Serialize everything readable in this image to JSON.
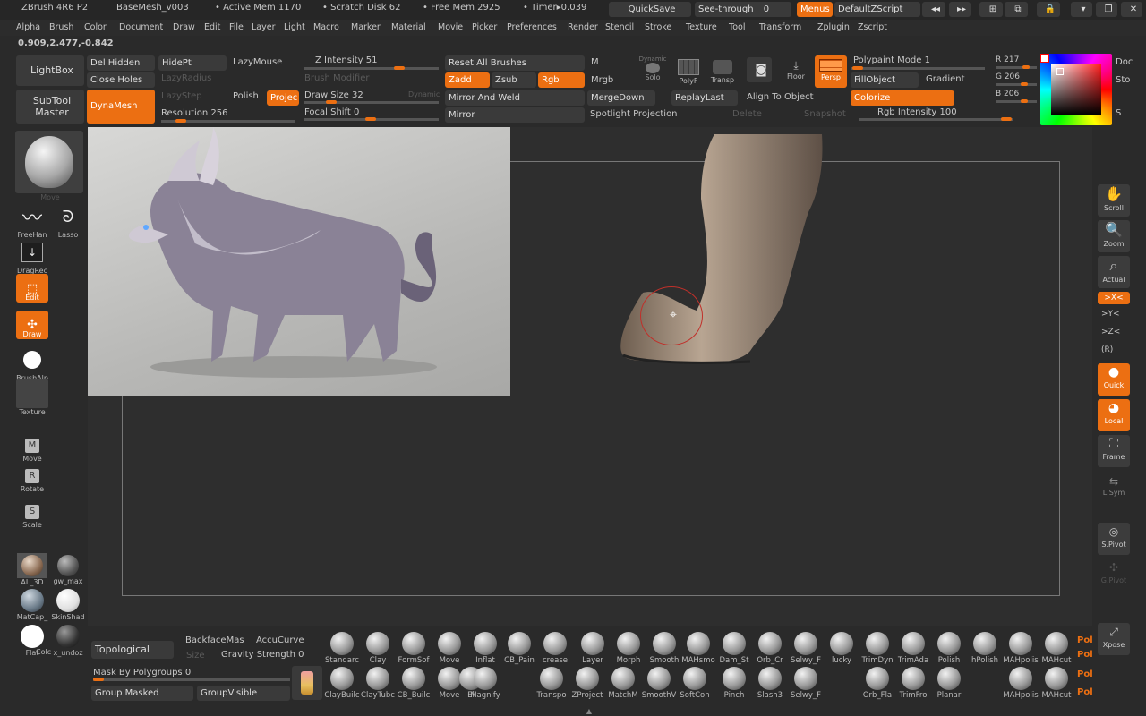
{
  "titlebar": {
    "app": "ZBrush 4R6 P2",
    "file": "BaseMesh_v003",
    "active_mem": "• Active Mem 1170",
    "scratch": "• Scratch Disk 62",
    "free_mem": "• Free Mem 2925",
    "timer": "• Timer▸0.039",
    "quicksave": "QuickSave",
    "seethrough": "See-through",
    "seethrough_val": "0",
    "menus": "Menus",
    "defaultzscript": "DefaultZScript"
  },
  "menubar": [
    "Alpha",
    "Brush",
    "Color",
    "Document",
    "Draw",
    "Edit",
    "File",
    "Layer",
    "Light",
    "Macro",
    "Marker",
    "Material",
    "Movie",
    "Picker",
    "Preferences",
    "Render",
    "Stencil",
    "Stroke",
    "Texture",
    "Tool",
    "Transform",
    "Zplugin",
    "Zscript"
  ],
  "coords": "0.909,2.477,-0.842",
  "shelf": {
    "lightbox": "LightBox",
    "subtool_master": "SubTool Master",
    "del_hidden": "Del Hidden",
    "close_holes": "Close Holes",
    "dynamesh": "DynaMesh",
    "hidept": "HidePt",
    "lazyradius": "LazyRadius",
    "lazymouse": "LazyMouse",
    "lazystep": "LazyStep",
    "polish": "Polish",
    "project": "Projec",
    "resolution": "Resolution 256",
    "z_intensity": "Z Intensity 51",
    "brush_modifier": "Brush Modifier",
    "draw_size": "Draw Size 32",
    "dynamic": "Dynamic",
    "focal_shift": "Focal Shift 0",
    "reset_brushes": "Reset All Brushes",
    "zadd": "Zadd",
    "zsub": "Zsub",
    "rgb": "Rgb",
    "mirror_weld": "Mirror And Weld",
    "mirror": "Mirror",
    "m": "M",
    "mrgb": "Mrgb",
    "dynamic_solo": "Dynamic",
    "solo": "Solo",
    "polyf": "PolyF",
    "transp": "Transp",
    "floor": "Floor",
    "persp": "Persp",
    "mergedown": "MergeDown",
    "replaylast": "ReplayLast",
    "align": "Align To Object",
    "spotlight": "Spotlight Projection",
    "delete": "Delete",
    "snapshot": "Snapshot",
    "polypaint_mode": "Polypaint Mode 1",
    "fillobject": "FillObject",
    "gradient": "Gradient",
    "colorize": "Colorize",
    "rgb_intensity": "Rgb Intensity 100",
    "r": "R 217",
    "g": "G 206",
    "b": "B 206",
    "doc": "Doc",
    "sto": "Sto",
    "s": "S"
  },
  "left": {
    "move": "Move",
    "freehand": "FreeHan",
    "lasso": "Lasso",
    "dragrect": "DragRec",
    "edit": "Edit",
    "draw": "Draw",
    "brushalpha": "BrushAlp",
    "texture": "Texture",
    "move_mode": "Move",
    "rotate": "Rotate",
    "scale": "Scale",
    "mat1": "AL_3D",
    "mat2": "gw_max",
    "mat3": "MatCap_",
    "mat4": "SkinShad",
    "flat": "Flat",
    "color": "Colc",
    "undo": "x_undoz"
  },
  "right": {
    "scroll": "Scroll",
    "zoom": "Zoom",
    "actual": "Actual",
    "xaxis": ">X<",
    "yaxis": ">Y<",
    "zaxis": ">Z<",
    "r": "(R)",
    "quick": "Quick",
    "local": "Local",
    "frame": "Frame",
    "lsym": "L.Sym",
    "spivot": "S.Pivot",
    "gpivot": "G.Pivot",
    "xpose": "Xpose"
  },
  "bottom": {
    "topological": "Topological",
    "backface": "BackfaceMas",
    "accucurve": "AccuCurve",
    "size": "Size",
    "gravity": "Gravity Strength 0",
    "mask_polygroups": "Mask By Polygroups 0",
    "group_masked": "Group Masked",
    "group_visible": "GroupVisible",
    "row1": [
      "Standarc",
      "Clay",
      "FormSof",
      "Move",
      "Inflat",
      "CB_Pain",
      "crease",
      "Layer",
      "Morph",
      "Smooth",
      "MAHsmo",
      "Dam_St",
      "Orb_Cr",
      "Selwy_F",
      "lucky",
      "TrimDyn",
      "TrimAda",
      "Polish",
      "hPolish",
      "MAHpolis",
      "MAHcut"
    ],
    "row2": [
      "ClayBuilc",
      "ClayTubc",
      "CB_Builc",
      "Move",
      "El",
      "Magnify",
      "Transpo",
      "ZProject",
      "MatchM",
      "SmoothV",
      "SoftCon",
      "Pinch",
      "Slash3",
      "Selwy_F",
      "Orb_Fla",
      "TrimFro",
      "Planar",
      "MAHpolis",
      "MAHcut"
    ],
    "pol": "Pol"
  },
  "colors": {
    "accent": "#ec6f12",
    "bg": "#2a2a2a",
    "panel": "#3a3a3a"
  }
}
